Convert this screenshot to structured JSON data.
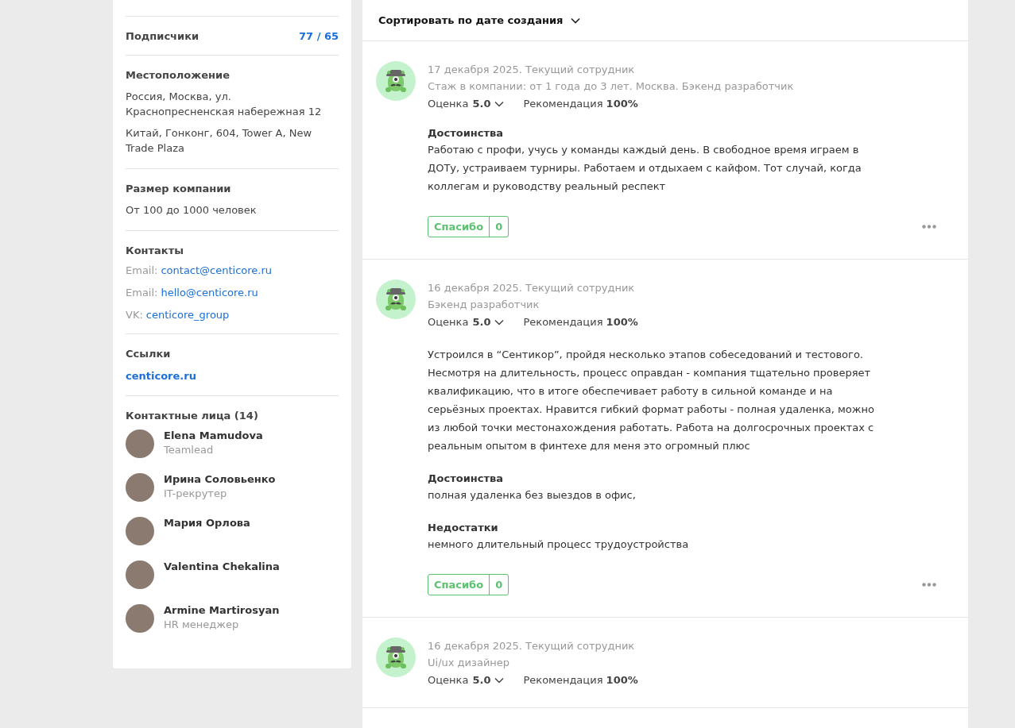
{
  "sidebar": {
    "sections": [
      {
        "kind": "stat",
        "title": "Подписчики",
        "value": "77 / 65"
      },
      {
        "kind": "lines",
        "title": "Местоположение",
        "lines": [
          "Россия, Москва, ул. Краснопресненская набережная 12",
          "Китай, Гонконг, 604, Tower A, New Trade Plaza"
        ]
      },
      {
        "kind": "lines",
        "title": "Размер компании",
        "lines": [
          "От 100 до 1000 человек"
        ]
      },
      {
        "kind": "contacts",
        "title": "Контакты",
        "contacts": [
          {
            "label": "Email:",
            "value": "contact@centicore.ru"
          },
          {
            "label": "Email:",
            "value": "hello@centicore.ru"
          },
          {
            "label": "VK:",
            "value": "centicore_group"
          }
        ]
      },
      {
        "kind": "links",
        "title": "Ссылки",
        "links": [
          "centicore.ru"
        ]
      },
      {
        "kind": "people",
        "title": "Контактные лица (14)",
        "people": [
          {
            "name": "Elena Mamudova",
            "role": "Teamlead"
          },
          {
            "name": "Ирина Соловьенко",
            "role": "IT-рекрутер"
          },
          {
            "name": "Мария Орлова"
          },
          {
            "name": "Valentina Chekalina"
          },
          {
            "name": "Armine Martirosyan",
            "role": "HR менеджер"
          }
        ]
      }
    ]
  },
  "sort": {
    "label": "Сортировать по дате создания"
  },
  "reviews": [
    {
      "date": "17 декабря 2025. Текущий сотрудник",
      "subtitle": "Стаж в компании: от 1 года до 3 лет. Москва. Бэкенд разработчик",
      "rating_label": "Оценка",
      "rating": "5.0",
      "recommend_label": "Рекомендация",
      "recommend": "100%",
      "blocks": [
        {
          "title": "Достоинства",
          "text": "Работаю с профи, учусь у команды каждый день. В свободное время играем в ДОТу, устраиваем турниры. Работаем и отдыхаем с кайфом. Тот случай, когда коллегам и руководству реальный респект"
        }
      ],
      "thanks": "Спасибо",
      "count": "0"
    },
    {
      "date": "16 декабря 2025. Текущий сотрудник",
      "subtitle": "Бэкенд разработчик",
      "rating_label": "Оценка",
      "rating": "5.0",
      "recommend_label": "Рекомендация",
      "recommend": "100%",
      "blocks": [
        {
          "text": "Устроился в “Сентикор”, пройдя несколько этапов собеседований и тестового. Несмотря на длительность, процесс оправдан - компания тщательно проверяет квалификацию, что в итоге обеспечивает работу в сильной команде и на серьёзных проектах. Нравится гибкий формат работы - полная удаленка, можно из любой точки местонахождения работать. Работа на долгосрочных проектах с реальным опытом в финтехе для меня это огромный плюс"
        },
        {
          "title": "Достоинства",
          "text": "полная удаленка без выездов в офис,"
        },
        {
          "title": "Недостатки",
          "text": "немного длительный процесс трудоустройства"
        }
      ],
      "thanks": "Спасибо",
      "count": "0"
    },
    {
      "date": "16 декабря 2025. Текущий сотрудник",
      "subtitle": "Ui/ux дизайнер",
      "rating_label": "Оценка",
      "rating": "5.0",
      "recommend_label": "Рекомендация",
      "recommend": "100%"
    }
  ]
}
